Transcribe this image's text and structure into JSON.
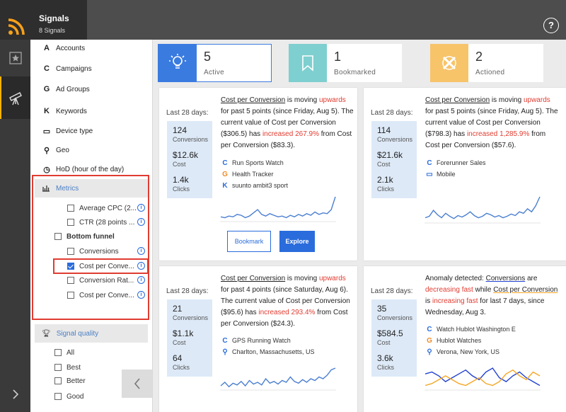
{
  "app": {
    "title": "Signals",
    "subtitle": "8 Signals"
  },
  "icons": {
    "rss": "rss-icon",
    "help": "help-icon",
    "star": "star-icon",
    "telescope": "telescope-icon"
  },
  "help_glyph": "?",
  "sidebar": {
    "nav": [
      {
        "glyph": "A",
        "label": "Accounts"
      },
      {
        "glyph": "C",
        "label": "Campaigns"
      },
      {
        "glyph": "G",
        "label": "Ad Groups"
      },
      {
        "glyph": "K",
        "label": "Keywords"
      },
      {
        "glyph": "▭",
        "label": "Device type"
      },
      {
        "glyph": "⚲",
        "label": "Geo"
      },
      {
        "glyph": "◷",
        "label": "HoD (hour of the day)"
      }
    ],
    "metrics_label": "Metrics",
    "metrics_items": [
      {
        "label": "Average CPC (2...",
        "checked": false
      },
      {
        "label": "CTR (28 points ...",
        "checked": false
      }
    ],
    "bottom_funnel": {
      "label": "Bottom funnel",
      "checked": false
    },
    "funnel_items": [
      {
        "label": "Conversions",
        "checked": false
      },
      {
        "label": "Cost per Conve...",
        "checked": true
      },
      {
        "label": "Conversion Rat...",
        "checked": false
      },
      {
        "label": "Cost per Conve...",
        "checked": false
      }
    ],
    "info_glyph": "i",
    "signal_quality_label": "Signal quality",
    "quality_items": [
      "All",
      "Best",
      "Better",
      "Good"
    ]
  },
  "tabs": [
    {
      "count": "5",
      "label": "Active"
    },
    {
      "count": "1",
      "label": "Bookmarked"
    },
    {
      "count": "2",
      "label": "Actioned"
    }
  ],
  "cards": [
    {
      "period": "Last 28 days:",
      "stats": [
        {
          "value": "124",
          "label": "Conversions"
        },
        {
          "value": "$12.6k",
          "label": "Cost"
        },
        {
          "value": "1.4k",
          "label": "Clicks"
        }
      ],
      "desc": {
        "metric": "Cost per Conversion",
        "t1": " is moving ",
        "dir": "upwards",
        "t2": " for past 5 points (since Friday, Aug 5). The current value of Cost per Conversion ($306.5) has ",
        "chg": "increased 267.9%",
        "t3": " from Cost per Conversion ($83.3)."
      },
      "entities": [
        {
          "glyph": "C",
          "text": "Run Sports Watch"
        },
        {
          "glyph": "G",
          "text": "Health Tracker"
        },
        {
          "glyph": "K",
          "text": "suunto ambit3 sport"
        }
      ],
      "trend": [
        5,
        4,
        6,
        5,
        8,
        7,
        4,
        6,
        10,
        14,
        8,
        6,
        9,
        7,
        5,
        6,
        4,
        7,
        5,
        8,
        6,
        9,
        7,
        11,
        8,
        10,
        9,
        14,
        30
      ],
      "buttons": {
        "bookmark": "Bookmark",
        "explore": "Explore"
      }
    },
    {
      "period": "Last 28 days:",
      "stats": [
        {
          "value": "114",
          "label": "Conversions"
        },
        {
          "value": "$21.6k",
          "label": "Cost"
        },
        {
          "value": "2.1k",
          "label": "Clicks"
        }
      ],
      "desc": {
        "metric": "Cost per Conversion",
        "t1": " is moving ",
        "dir": "upwards",
        "t2": " for past 5 points (since Friday, Aug 5). The current value of Cost per Conversion ($798.3) has ",
        "chg": "increased 1,285.9%",
        "t3": " from Cost per Conversion ($57.6)."
      },
      "entities": [
        {
          "glyph": "C",
          "text": "Forerunner Sales"
        },
        {
          "glyph": "▭",
          "text": "Mobile"
        }
      ],
      "trend": [
        6,
        8,
        16,
        10,
        6,
        12,
        8,
        5,
        9,
        7,
        10,
        14,
        9,
        6,
        8,
        12,
        10,
        7,
        9,
        6,
        8,
        11,
        9,
        14,
        12,
        18,
        14,
        22,
        34
      ]
    },
    {
      "period": "Last 28 days:",
      "stats": [
        {
          "value": "21",
          "label": "Conversions"
        },
        {
          "value": "$1.1k",
          "label": "Cost"
        },
        {
          "value": "64",
          "label": "Clicks"
        }
      ],
      "desc": {
        "metric": "Cost per Conversion",
        "t1": " is moving ",
        "dir": "upwards",
        "t2": " for past 4 points (since Saturday, Aug 6). The current value of Cost per Conversion ($95.6) has ",
        "chg": "increased 293.4%",
        "t3": " from Cost per Conversion ($24.3)."
      },
      "entities": [
        {
          "glyph": "C",
          "text": "GPS Running Watch"
        },
        {
          "glyph": "⚲",
          "text": "Charlton, Massachusetts, US"
        }
      ],
      "trend": [
        4,
        8,
        3,
        7,
        5,
        9,
        4,
        10,
        6,
        8,
        5,
        12,
        7,
        9,
        6,
        10,
        8,
        14,
        9,
        7,
        11,
        8,
        12,
        10,
        14,
        12,
        16,
        22,
        24
      ]
    },
    {
      "period": "Last 28 days:",
      "stats": [
        {
          "value": "35",
          "label": "Conversions"
        },
        {
          "value": "$584.5",
          "label": "Cost"
        },
        {
          "value": "3.6k",
          "label": "Clicks"
        }
      ],
      "anomaly": {
        "t0": "Anomaly detected: ",
        "m1": "Conversions",
        "t1": " are ",
        "d1": "decreasing fast",
        "t2": " while ",
        "m2": "Cost per Conversion",
        "t3": " is ",
        "d2": "increasing fast",
        "t4": " for last 7 days, since Wednesday, Aug 3."
      },
      "entities": [
        {
          "glyph": "C",
          "text": "Watch Hublot Washington E"
        },
        {
          "glyph": "G",
          "text": "Hublot Watches"
        },
        {
          "glyph": "⚲",
          "text": "Verona, New York, US"
        }
      ],
      "trend_blue": [
        16,
        18,
        14,
        8,
        12,
        16,
        20,
        14,
        10,
        18,
        22,
        12,
        8,
        14,
        18,
        12,
        8,
        4
      ],
      "trend_orange": [
        4,
        6,
        10,
        14,
        10,
        6,
        4,
        8,
        12,
        6,
        4,
        8,
        16,
        20,
        14,
        10,
        18,
        14
      ],
      "colors": {
        "blue": "#1f3fd1",
        "orange": "#f5a623"
      }
    }
  ],
  "colors": {
    "accent": "#2a6cdc",
    "red": "#e03c31",
    "active_tile": "#3a7be0",
    "bookmark_tile": "#7ecfcf",
    "actioned_tile": "#f7c46a",
    "spark": "#4a7fd0"
  }
}
